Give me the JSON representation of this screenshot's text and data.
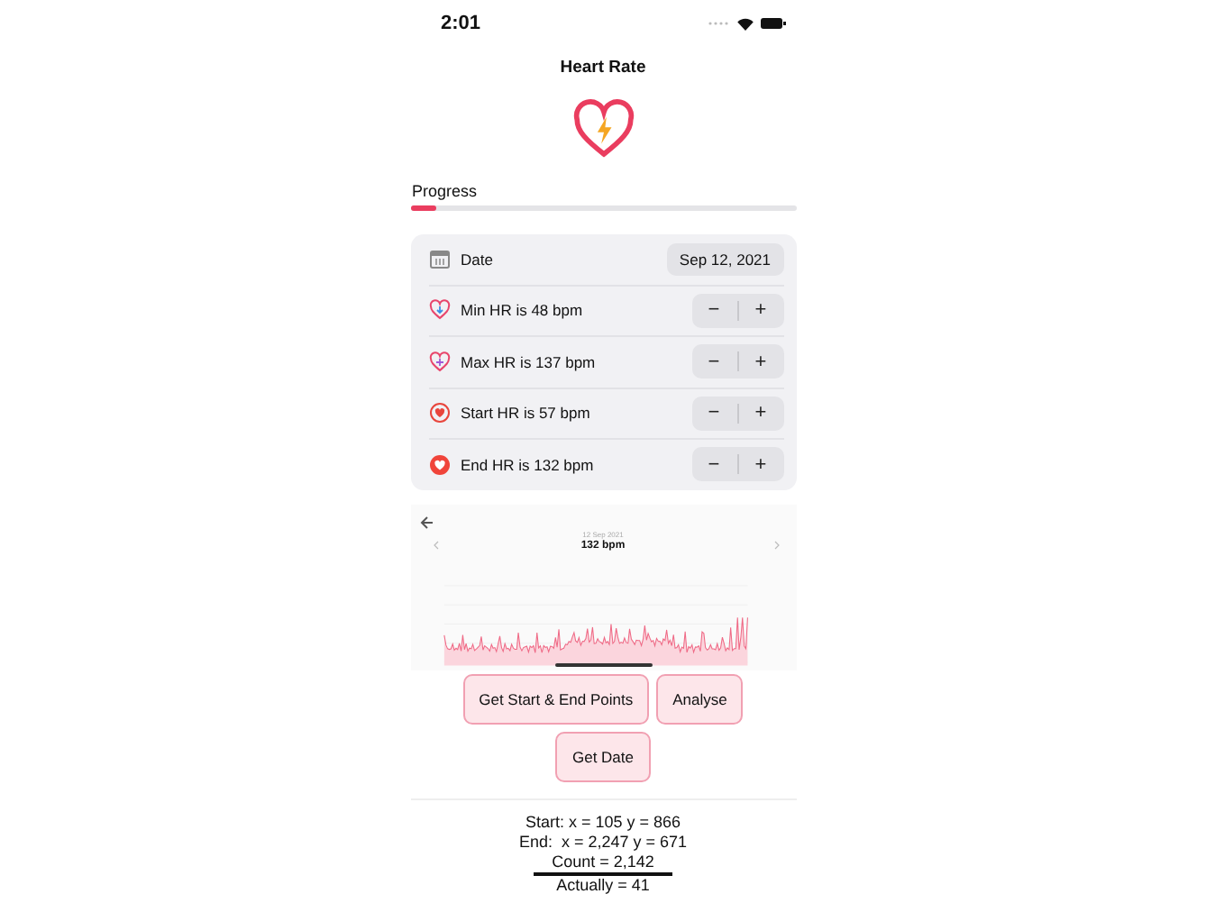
{
  "status_bar": {
    "time": "2:01"
  },
  "title": "Heart Rate",
  "progress": {
    "label": "Progress",
    "level": 0.07
  },
  "settings": {
    "date": {
      "label": "Date",
      "value": "Sep 12, 2021"
    },
    "rows": [
      {
        "kind": "min",
        "label": "Min HR is 48 bpm",
        "minus": "−",
        "plus": "+"
      },
      {
        "kind": "max",
        "label": "Max HR is 137 bpm",
        "minus": "−",
        "plus": "+"
      },
      {
        "kind": "start",
        "label": "Start HR is 57 bpm",
        "minus": "−",
        "plus": "+"
      },
      {
        "kind": "end",
        "label": "End HR is 132 bpm",
        "minus": "−",
        "plus": "+"
      }
    ]
  },
  "chart_screenshot": {
    "date": "12 Sep 2021",
    "reading": "132 bpm"
  },
  "buttons": [
    "Get Start & End Points",
    "Analyse",
    "Get Date"
  ],
  "results": [
    {
      "text": "Start: x = 105 y = 866",
      "underlined": false
    },
    {
      "text": "End:  x = 2,247 y = 671",
      "underlined": false
    },
    {
      "text": "Count = 2,142",
      "underlined": true
    },
    {
      "text": "Actually = 41",
      "underlined": false
    }
  ]
}
